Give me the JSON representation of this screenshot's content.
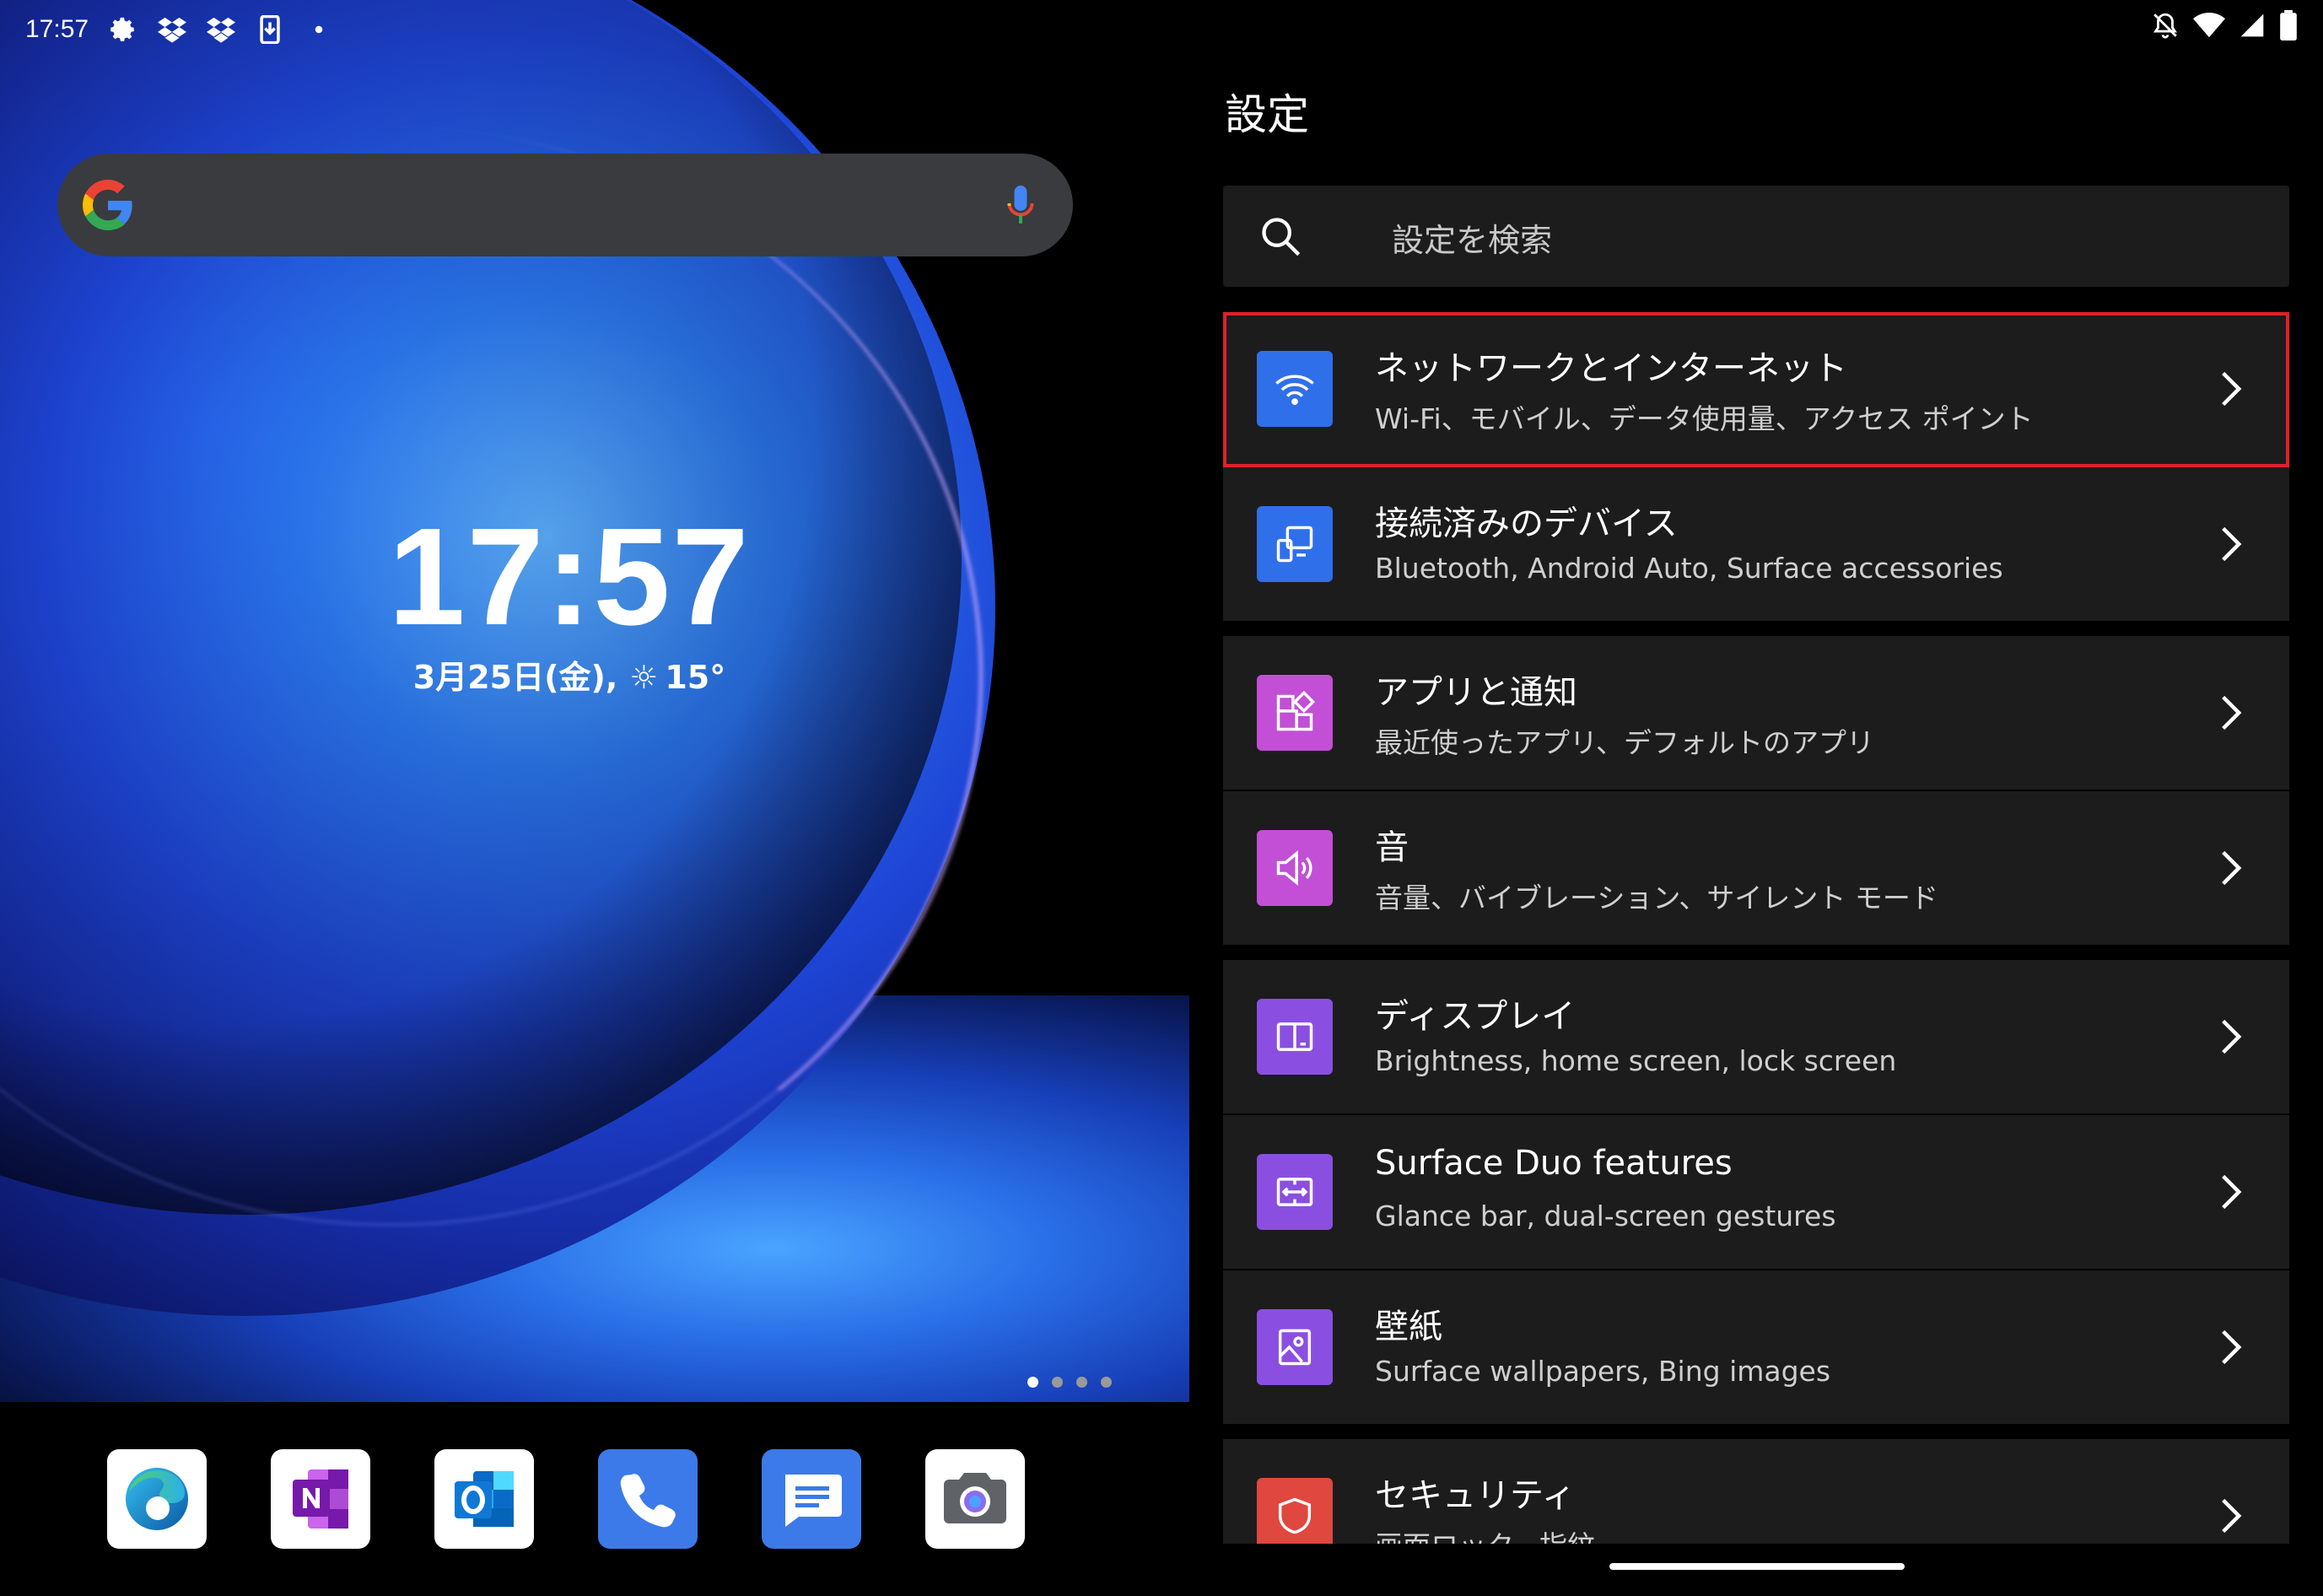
{
  "left_screen": {
    "status_bar": {
      "time": "17:57",
      "icons": [
        "gear-icon",
        "dropbox-icon",
        "dropbox-icon",
        "download-icon",
        "dot-icon"
      ]
    },
    "search_bar": {
      "logo": "google-g-icon",
      "mic": "mic-icon"
    },
    "clock": {
      "time": "17:57",
      "date": "3月25日(金),",
      "weather_icon": "☼",
      "temperature": "15°"
    },
    "page_indicator": {
      "count": 4,
      "active": 1
    },
    "dock_apps": [
      {
        "name": "Microsoft Edge",
        "icon": "edge-icon"
      },
      {
        "name": "OneNote",
        "icon": "onenote-icon"
      },
      {
        "name": "Outlook",
        "icon": "outlook-icon"
      },
      {
        "name": "Phone",
        "icon": "phone-icon"
      },
      {
        "name": "Messages",
        "icon": "messages-icon"
      },
      {
        "name": "Camera",
        "icon": "camera-icon"
      }
    ]
  },
  "right_screen": {
    "status_bar": {
      "icons": [
        "bell-off-icon",
        "wifi-icon",
        "signal-icon",
        "battery-icon"
      ]
    },
    "title": "設定",
    "search": {
      "placeholder": "設定を検索"
    },
    "items": [
      {
        "title": "ネットワークとインターネット",
        "subtitle": "Wi-Fi、モバイル、データ使用量、アクセス ポイント",
        "icon": "wifi-icon",
        "color": "#2f6fea",
        "highlighted": true
      },
      {
        "title": "接続済みのデバイス",
        "subtitle": "Bluetooth, Android Auto, Surface accessories",
        "icon": "devices-icon",
        "color": "#2f6fea"
      },
      {
        "title": "アプリと通知",
        "subtitle": "最近使ったアプリ、デフォルトのアプリ",
        "icon": "apps-icon",
        "color": "#c24fd6"
      },
      {
        "title": "音",
        "subtitle": "音量、バイブレーション、サイレント モード",
        "icon": "speaker-icon",
        "color": "#c24fd6"
      },
      {
        "title": "ディスプレイ",
        "subtitle": "Brightness, home screen, lock screen",
        "icon": "display-icon",
        "color": "#8a4fe0"
      },
      {
        "title": "Surface Duo features",
        "subtitle": "Glance bar, dual-screen gestures",
        "icon": "dual-screen-icon",
        "color": "#8a4fe0"
      },
      {
        "title": "壁紙",
        "subtitle": "Surface wallpapers, Bing images",
        "icon": "wallpaper-icon",
        "color": "#8a4fe0"
      },
      {
        "title": "セキュリティ",
        "subtitle": "画面ロック、指紋",
        "icon": "shield-icon",
        "color": "#e0473f"
      }
    ]
  }
}
